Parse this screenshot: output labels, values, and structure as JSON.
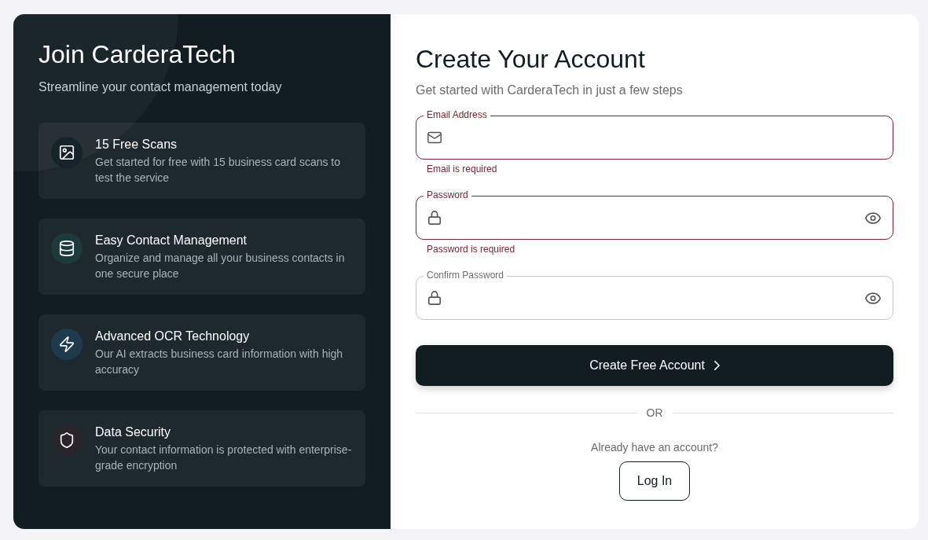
{
  "signup_promo": {
    "title": "Join CarderaTech",
    "subtitle": "Streamline your contact management today",
    "features": [
      {
        "kind": "scans",
        "title": "15 Free Scans",
        "description": "Get started for free with 15 business card scans to test the service",
        "color": "#17232a"
      },
      {
        "kind": "contacts",
        "title": "Easy Contact Management",
        "description": "Organize and manage all your business contacts in one secure place",
        "color": "#1c393c"
      },
      {
        "kind": "ocr",
        "title": "Advanced OCR Technology",
        "description": "Our AI extracts business card information with high accuracy",
        "color": "#1e3a4d"
      },
      {
        "kind": "security",
        "title": "Data Security",
        "description": "Your contact information is protected with enterprise-grade encryption",
        "color": "#28262a"
      }
    ]
  },
  "signup_form": {
    "title": "Create Your Account",
    "subtitle": "Get started with CarderaTech in just a few steps",
    "fields": [
      {
        "kind": "email",
        "label": "Email Address",
        "invalid": true,
        "error": "Email is required"
      },
      {
        "kind": "password",
        "label": "Password",
        "invalid": true,
        "error": "Password is required"
      },
      {
        "kind": "password",
        "label": "Confirm Password",
        "invalid": false
      }
    ],
    "submit_button": "Create Free Account",
    "divider": "OR",
    "login_prompt": "Already have an account?",
    "login_button": "Log In"
  }
}
